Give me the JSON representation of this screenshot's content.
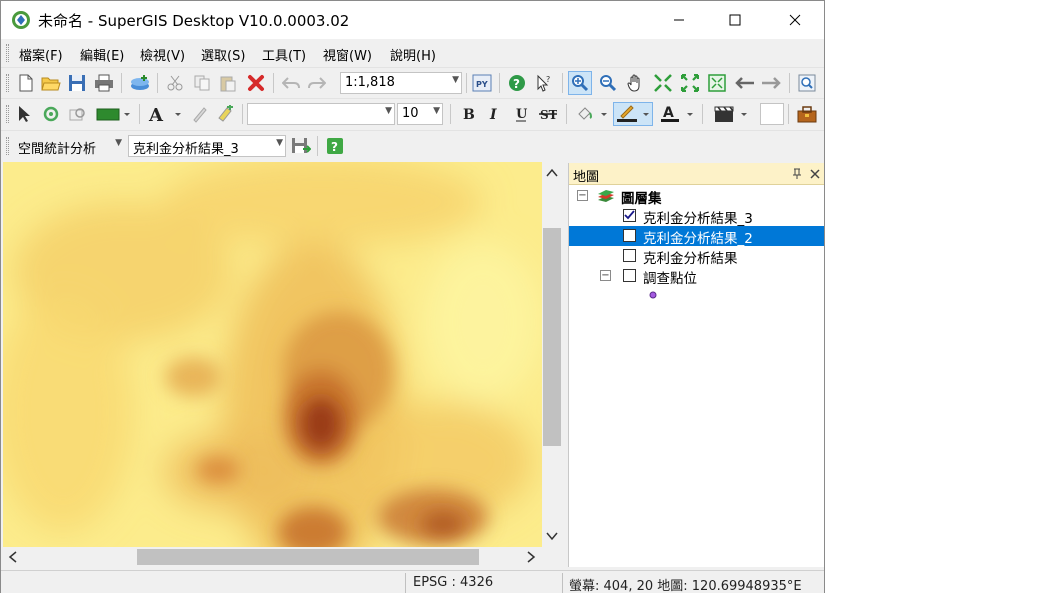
{
  "window": {
    "title": "未命名 - SuperGIS Desktop V10.0.0003.02"
  },
  "menu": [
    "檔案(F)",
    "編輯(E)",
    "檢視(V)",
    "選取(S)",
    "工具(T)",
    "視窗(W)",
    "說明(H)"
  ],
  "toolbar1": {
    "scale_value": "1:1,818"
  },
  "toolbar2": {
    "font_size": "10"
  },
  "toolbar3": {
    "analysis_dropdown": "空間統計分析",
    "layer_dropdown": "克利金分析結果_3"
  },
  "layer_panel": {
    "title": "地圖",
    "root": "圖層集",
    "layers": [
      {
        "name": "克利金分析結果_3",
        "checked": true
      },
      {
        "name": "克利金分析結果_2",
        "checked": false
      },
      {
        "name": "克利金分析結果",
        "checked": false
      },
      {
        "name": "調查點位",
        "checked": false
      }
    ]
  },
  "status": {
    "crs": "EPSG : 4326",
    "coords": "螢幕: 404, 20  地圖: 120.69948935°E"
  },
  "colors": {
    "accent": "#0078d7",
    "panel_header": "#fdf2c8",
    "map_low": "#fdf59a",
    "map_high": "#8a2e0c"
  }
}
